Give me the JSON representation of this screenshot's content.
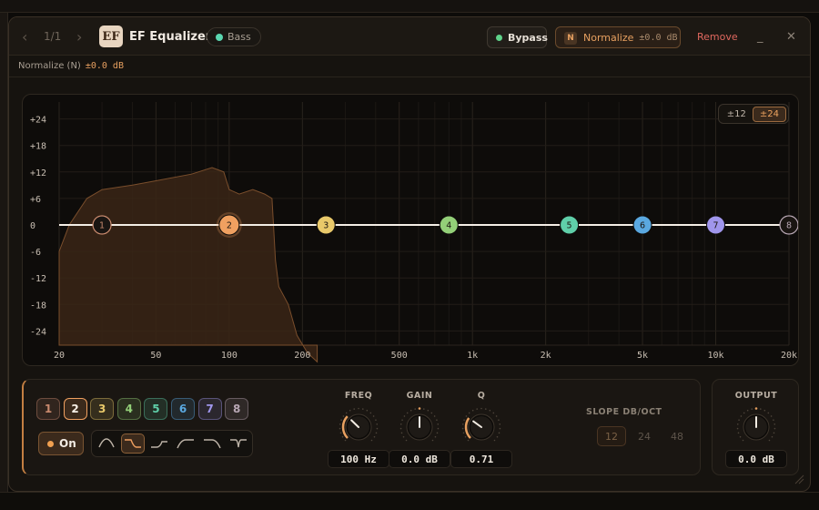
{
  "titlebar": {
    "page_indicator": "1/1",
    "logo_text": "EF",
    "title": "EF Equalizer",
    "preset_tag": "Bass",
    "bypass_label": "Bypass",
    "normalize_badge": "N",
    "normalize_label": "Normalize",
    "normalize_value": "±0.0 dB",
    "remove_label": "Remove",
    "minimize_icon": "minimize-icon",
    "close_icon": "close-icon"
  },
  "normalize_row": {
    "label": "Normalize (N)",
    "value": "±0.0 dB"
  },
  "graph": {
    "range_options": [
      "±12",
      "±24"
    ],
    "range_selected": "±24",
    "db_ticks": [
      "+24",
      "+18",
      "+12",
      "+6",
      "0",
      "-6",
      "-12",
      "-18",
      "-24"
    ],
    "freq_ticks": [
      "20",
      "50",
      "100",
      "200",
      "500",
      "1k",
      "2k",
      "5k",
      "10k",
      "20k"
    ],
    "selected_band": "2"
  },
  "bands": [
    {
      "label": "1",
      "freq_hz": 30,
      "gain_db": 0,
      "color": "#c98a6e"
    },
    {
      "label": "2",
      "freq_hz": 100,
      "gain_db": 0,
      "color": "#f0a060"
    },
    {
      "label": "3",
      "freq_hz": 250,
      "gain_db": 0,
      "color": "#e9c96a"
    },
    {
      "label": "4",
      "freq_hz": 800,
      "gain_db": 0,
      "color": "#93cf78"
    },
    {
      "label": "5",
      "freq_hz": 2500,
      "gain_db": 0,
      "color": "#5fcfa9"
    },
    {
      "label": "6",
      "freq_hz": 5000,
      "gain_db": 0,
      "color": "#5aa8e0"
    },
    {
      "label": "7",
      "freq_hz": 10000,
      "gain_db": 0,
      "color": "#a096ec"
    },
    {
      "label": "8",
      "freq_hz": 20000,
      "gain_db": 0,
      "color": "#b9a8b5"
    }
  ],
  "controls": {
    "band_buttons": [
      "1",
      "2",
      "3",
      "4",
      "5",
      "6",
      "7",
      "8"
    ],
    "selected_band": "2",
    "on_label": "On",
    "filter_shapes": [
      "low-shelf-icon",
      "bell-icon",
      "high-shelf-icon",
      "low-cut-icon",
      "high-cut-icon",
      "notch-icon"
    ],
    "selected_shape": "bell-icon",
    "freq": {
      "label": "FREQ",
      "value": "100 Hz",
      "level": 0.33
    },
    "gain": {
      "label": "GAIN",
      "value": "0.0 dB",
      "level": 0.5
    },
    "q": {
      "label": "Q",
      "value": "0.71",
      "level": 0.3
    },
    "slope_label": "SLOPE DB/OCT",
    "slope_options": [
      "12",
      "24",
      "48"
    ],
    "slope_selected": "12"
  },
  "output": {
    "label": "OUTPUT",
    "value": "0.0 dB",
    "level": 0.5
  },
  "accent": "#e7a060"
}
